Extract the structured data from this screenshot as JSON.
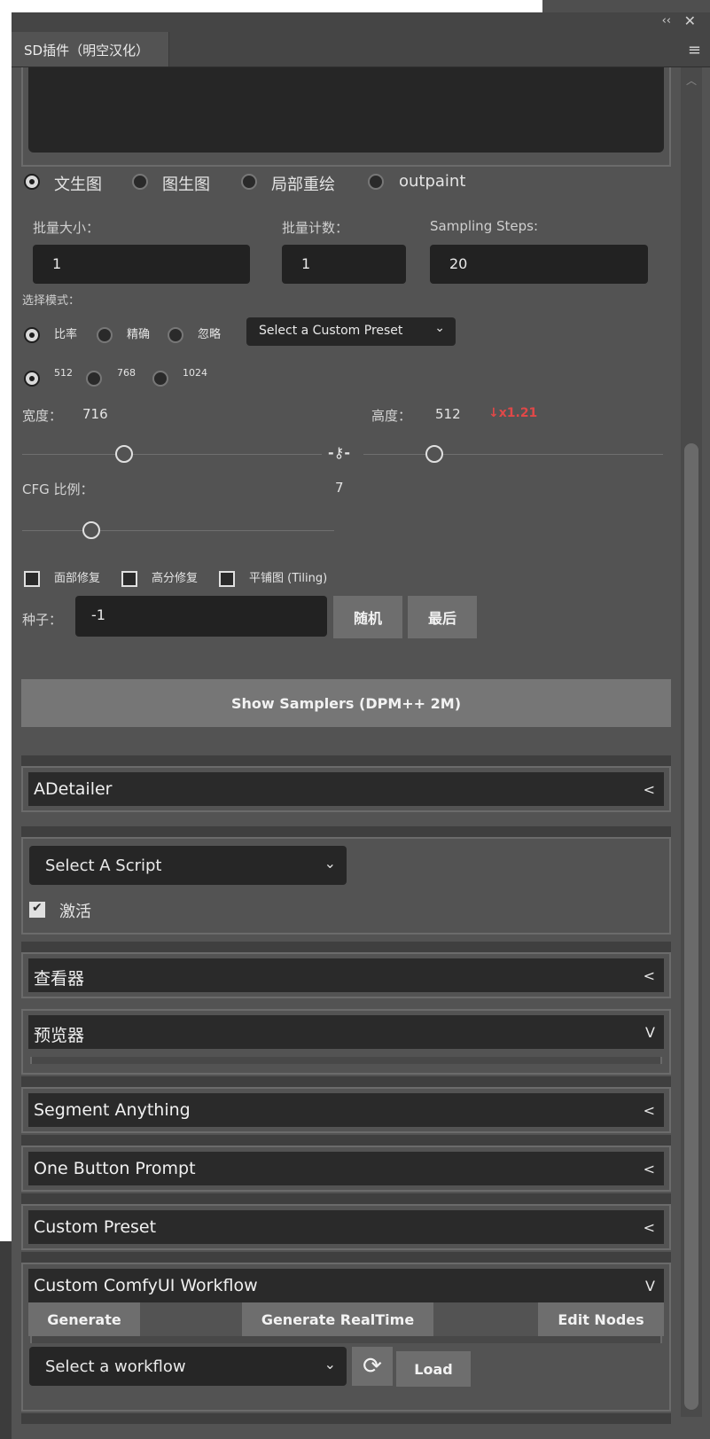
{
  "window": {
    "collapse_glyph": "‹‹",
    "close_glyph": "✕"
  },
  "tab": {
    "label": "SD插件（明空汉化）",
    "menu_glyph": "≡"
  },
  "mode_radios": [
    {
      "label": "文生图",
      "selected": true
    },
    {
      "label": "图生图",
      "selected": false
    },
    {
      "label": "局部重绘",
      "selected": false
    },
    {
      "label": "outpaint",
      "selected": false
    }
  ],
  "batch": {
    "size_label": "批量大小：",
    "size_value": "1",
    "count_label": "批量计数：",
    "count_value": "1",
    "steps_label": "Sampling Steps:",
    "steps_value": "20"
  },
  "selection_mode": {
    "label": "选择模式：",
    "options": [
      "比率",
      "精确",
      "忽略"
    ],
    "preset_placeholder": "Select a Custom Preset"
  },
  "resolution_options": [
    "512",
    "768",
    "1024"
  ],
  "size": {
    "width_label": "宽度：",
    "width_value": "716",
    "height_label": "高度：",
    "height_value": "512",
    "scale_text": "↓x1.21",
    "scale_color": "#e04848",
    "link_glyph": "-⚷-"
  },
  "cfg": {
    "label": "CFG 比例：",
    "value": "7"
  },
  "checkboxes": [
    "面部修复",
    "高分修复",
    "平铺图 (Tiling)"
  ],
  "seed": {
    "label": "种子：",
    "value": "-1",
    "random_label": "随机",
    "last_label": "最后"
  },
  "samplers_button": "Show Samplers (DPM++ 2M)",
  "sections": {
    "adetailer": "ADetailer",
    "script_select": "Select A Script",
    "activate": "激活",
    "viewer": "查看器",
    "previewer": "预览器",
    "segment": "Segment Anything",
    "one_button": "One Button Prompt",
    "custom_preset": "Custom Preset",
    "comfy": "Custom ComfyUI Workflow"
  },
  "arrows": {
    "collapsed": "<",
    "expanded": "V"
  },
  "comfy": {
    "generate": "Generate",
    "generate_realtime": "Generate RealTime",
    "edit_nodes": "Edit Nodes",
    "workflow_placeholder": "Select a workflow",
    "load": "Load",
    "refresh_glyph": "⟳"
  },
  "chevron_glyph": "⌄"
}
